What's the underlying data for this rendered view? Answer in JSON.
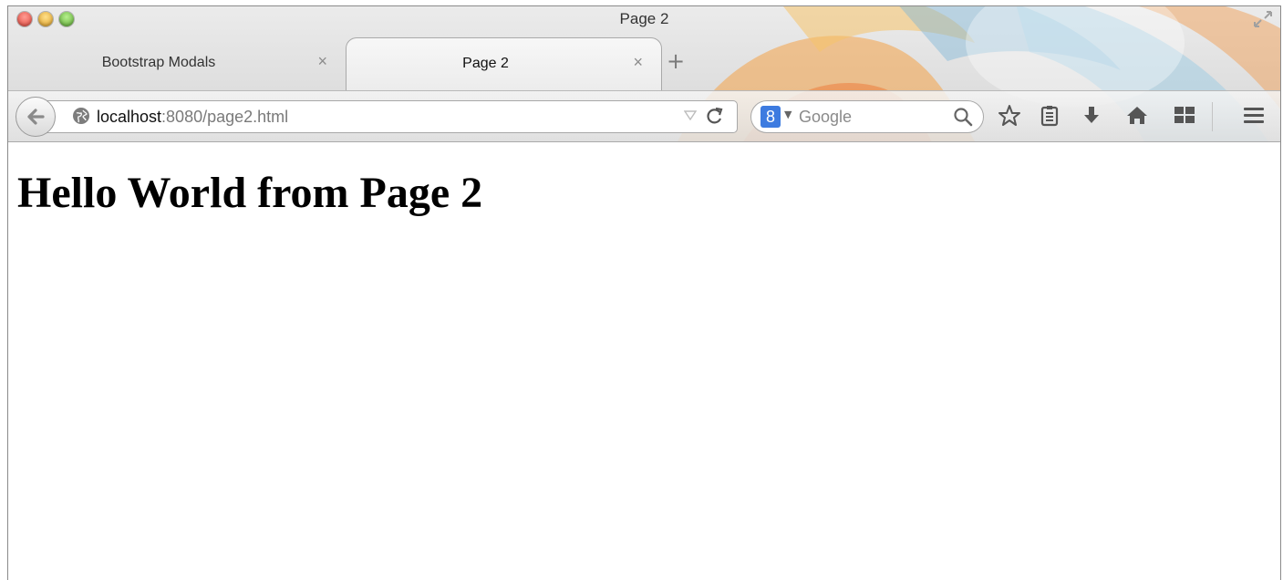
{
  "window": {
    "title": "Page 2"
  },
  "tabs": [
    {
      "label": "Bootstrap Modals",
      "close": "×",
      "active": false
    },
    {
      "label": "Page 2",
      "close": "×",
      "active": true
    }
  ],
  "new_tab_label": "+",
  "navbar": {
    "back_icon": "back-arrow-icon",
    "url": {
      "host": "localhost",
      "rest": ":8080/page2.html"
    },
    "search": {
      "engine_letter": "8",
      "placeholder": "Google"
    },
    "toolbar_icons": [
      "star-icon",
      "reading-list-icon",
      "download-icon",
      "home-icon",
      "panel-icon",
      "menu-icon"
    ]
  },
  "page": {
    "heading": "Hello World from Page 2"
  },
  "colors": {
    "chrome_bg": "#d6d6d6",
    "search_engine_blue": "#3d7be0",
    "persona_orange": "#f08a2b"
  }
}
